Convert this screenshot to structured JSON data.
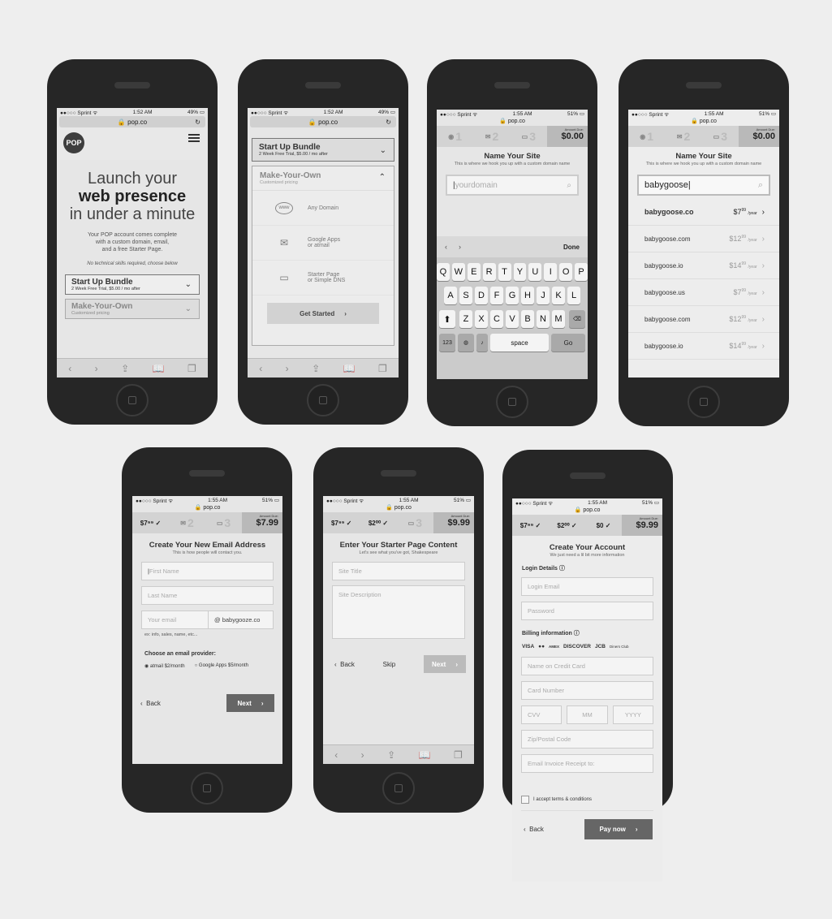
{
  "status": {
    "carrier": "●●○○○ Sprint ᯤ",
    "time_152": "1:52 AM",
    "time_155": "1:55 AM",
    "battery_49": "49% ▭",
    "battery_51": "51% ▭"
  },
  "url": "🔒 pop.co",
  "url_plain": "🔒 pop.co",
  "browser_icons": {
    "back": "‹",
    "forward": "›",
    "share": "⇪",
    "bookmarks": "📖",
    "tabs": "❐"
  },
  "screen1": {
    "logo": "POP",
    "hero_line1": "Launch your",
    "hero_line2": "web presence",
    "hero_line3": "in under a minute",
    "desc1": "Your POP account comes complete",
    "desc2": "with a custom domain, email,",
    "desc3": "and a free Starter Page.",
    "note": "No technical skills required, choose below",
    "bundle_title": "Start Up Bundle",
    "bundle_sub": "2 Week Free Trial, $5.00 / mo after",
    "myo_title": "Make-Your-Own",
    "myo_sub": "Customized pricing"
  },
  "screen2": {
    "bundle_title": "Start Up Bundle",
    "bundle_sub": "2 Week Free Trial, $5.00 / mo after",
    "myo_title": "Make-Your-Own",
    "myo_sub": "Customized pricing",
    "options": [
      {
        "icon": "www",
        "label": "Any Domain"
      },
      {
        "icon": "✉",
        "label": "Google Apps\nor atmail"
      },
      {
        "icon": "▭",
        "label": "Starter Page\nor Simple DNS"
      }
    ],
    "cta": "Get Started"
  },
  "amount_label": "Amount Due:",
  "screen3": {
    "amount": "$0.00",
    "title": "Name Your Site",
    "subtitle": "This is where we hook you up with a custom domain name",
    "placeholder": "yourdomain",
    "done": "Done",
    "rows": [
      [
        "Q",
        "W",
        "E",
        "R",
        "T",
        "Y",
        "U",
        "I",
        "O",
        "P"
      ],
      [
        "A",
        "S",
        "D",
        "F",
        "G",
        "H",
        "J",
        "K",
        "L"
      ],
      [
        "Z",
        "X",
        "C",
        "V",
        "B",
        "N",
        "M"
      ]
    ],
    "num": "123",
    "space": "space",
    "go": "Go"
  },
  "screen4": {
    "amount": "$0.00",
    "title": "Name Your Site",
    "subtitle": "This is where we hook you up with a custom domain name",
    "query": "babygoose",
    "results": [
      {
        "name": "babygoose.co",
        "price": "$7",
        "cents": "99",
        "per": "/year"
      },
      {
        "name": "babygoose.com",
        "price": "$12",
        "cents": "99",
        "per": "/year"
      },
      {
        "name": "babygoose.io",
        "price": "$14",
        "cents": "99",
        "per": "/year"
      },
      {
        "name": "babygoose.us",
        "price": "$7",
        "cents": "99",
        "per": "/year"
      },
      {
        "name": "babygoose.com",
        "price": "$12",
        "cents": "99",
        "per": "/year"
      },
      {
        "name": "babygoose.io",
        "price": "$14",
        "cents": "99",
        "per": "/year"
      }
    ]
  },
  "screen5": {
    "step1": "$7⁹⁹ ✓",
    "amount": "$7.99",
    "title": "Create Your New Email Address",
    "subtitle": "This is how people will contact you.",
    "first": "First Name",
    "last": "Last Name",
    "email": "Your email",
    "domain": "@  babygooze.co",
    "hint": "ex: info, sales, name, etc...",
    "provider_label": "Choose an email provider:",
    "opt1": "atmail $2/month",
    "opt2": "Google Apps $5/month",
    "back": "Back",
    "next": "Next"
  },
  "screen6": {
    "step1": "$7⁹⁹ ✓",
    "step2": "$2⁰⁰ ✓",
    "amount": "$9.99",
    "title": "Enter Your Starter Page Content",
    "subtitle": "Let's see what you've got, Shakespeare",
    "site_title": "Site Title",
    "site_desc": "Site Description",
    "back": "Back",
    "skip": "Skip",
    "next": "Next"
  },
  "screen7": {
    "step1": "$7⁹⁹ ✓",
    "step2": "$2⁰⁰ ✓",
    "step3": "$0 ✓",
    "amount": "$9.99",
    "title": "Create Your Account",
    "subtitle": "We just need a lil bit more information",
    "login_label": "Login Details ⓘ",
    "login_email": "Login Email",
    "password": "Password",
    "billing_label": "Billing information ⓘ",
    "cards": [
      "VISA",
      "●●",
      "AMEX",
      "DISCOVER",
      "JCB",
      "Diners Club"
    ],
    "name_cc": "Name on Credit Card",
    "card_number": "Card Number",
    "cvv": "CVV",
    "mm": "MM",
    "yyyy": "YYYY",
    "zip": "Zip/Postal Code",
    "invoice": "Email Invoice Receipt to:",
    "accept": "I accept terms & conditions",
    "back": "Back",
    "pay": "Pay now"
  }
}
